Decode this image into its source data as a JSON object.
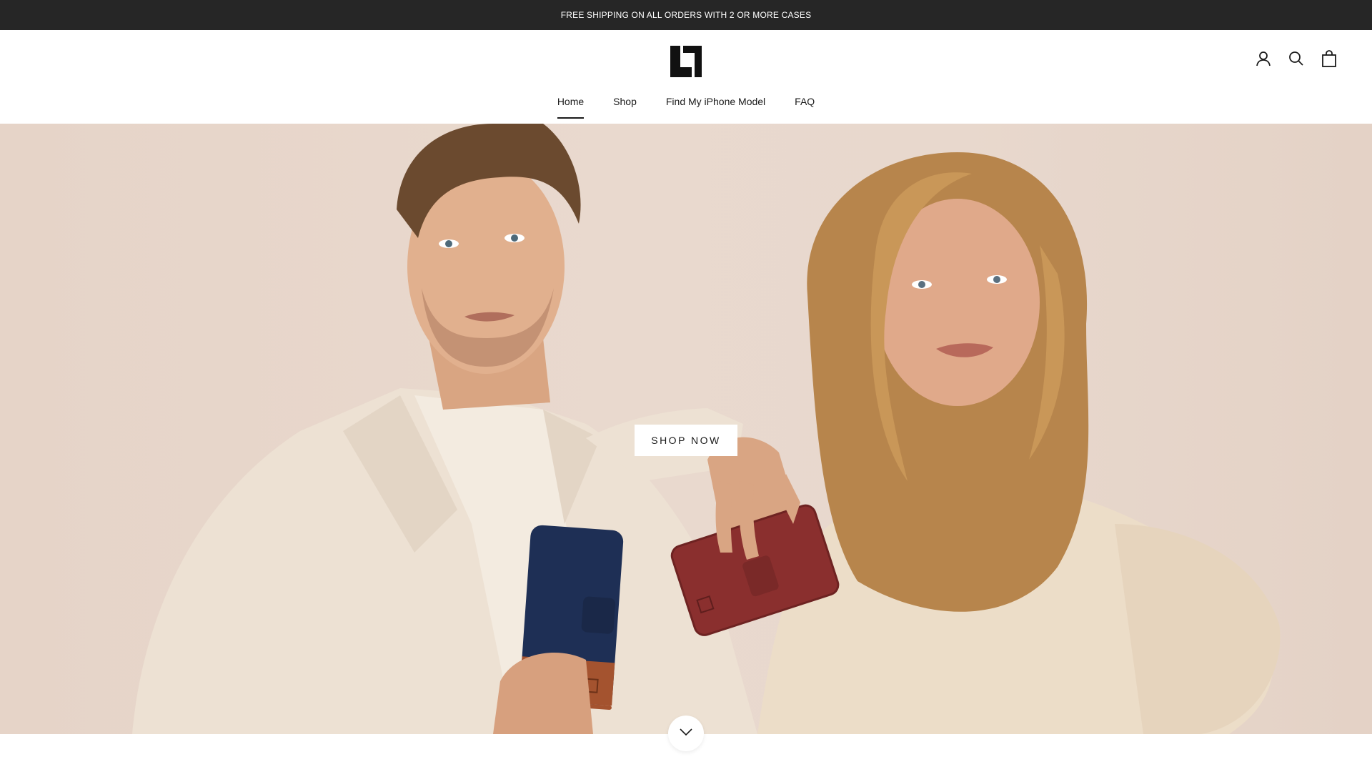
{
  "announcement": {
    "text": "FREE SHIPPING ON ALL ORDERS WITH 2 OR MORE CASES"
  },
  "header": {
    "logo_icon": "brand-logo-icon",
    "icons": [
      "account-icon",
      "search-icon",
      "cart-icon"
    ]
  },
  "nav": {
    "items": [
      {
        "label": "Home",
        "active": true
      },
      {
        "label": "Shop",
        "active": false
      },
      {
        "label": "Find My iPhone Model",
        "active": false
      },
      {
        "label": "FAQ",
        "active": false
      }
    ]
  },
  "hero": {
    "cta_label": "SHOP NOW",
    "scroll_icon": "chevron-down-icon"
  },
  "colors": {
    "announcement_bg": "#262626",
    "hero_bg": "#e8d8cd",
    "blue_case": "#1e2f55",
    "red_case": "#8a2f2e",
    "tan_leather": "#a4532f"
  }
}
